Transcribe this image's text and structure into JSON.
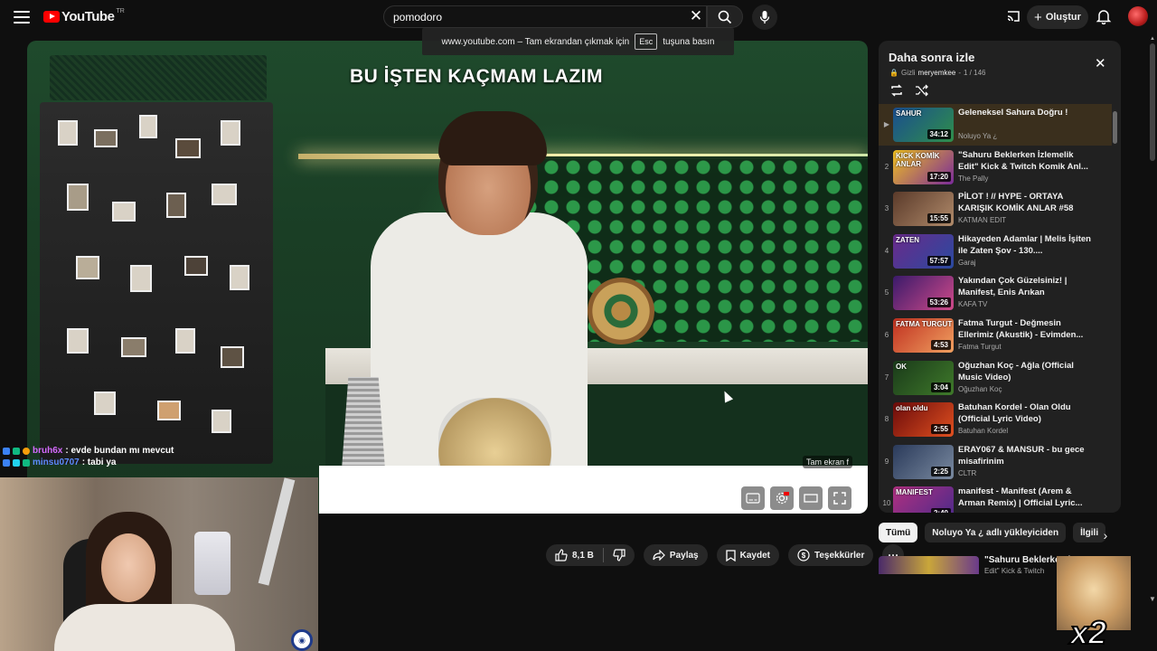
{
  "header": {
    "logo_text": "YouTube",
    "country_code": "TR",
    "search_value": "pomodoro",
    "create_label": "Oluştur",
    "icons": [
      "menu-icon",
      "youtube-logo-icon",
      "clear-icon",
      "search-icon",
      "mic-icon",
      "cast-icon",
      "plus-icon",
      "bell-icon",
      "avatar"
    ]
  },
  "fullscreen_notice": {
    "prefix": "www.youtube.com – Tam ekrandan çıkmak için",
    "key": "Esc",
    "suffix": "tuşuna basın"
  },
  "video": {
    "overlay_title": "BU İŞTEN KAÇMAM LAZIM",
    "tooltip": "Tam ekran",
    "tooltip_shortcut": "f",
    "controls": [
      "subtitles-icon",
      "settings-icon",
      "theater-icon",
      "fullscreen-icon"
    ]
  },
  "actions": {
    "like_count": "8,1 B",
    "share_label": "Paylaş",
    "save_label": "Kaydet",
    "thanks_label": "Teşekkürler"
  },
  "playlist": {
    "title": "Daha sonra izle",
    "privacy": "Gizli",
    "owner": "meryemkee",
    "position": "1 / 146",
    "active_color": "#3a2f1d",
    "items": [
      {
        "index": "▶",
        "title": "Geleneksel Sahura Doğru !",
        "channel": "Noluyo Ya ¿",
        "duration": "34:12",
        "thumb_text": "SAHUR"
      },
      {
        "index": "2",
        "title": "\"Sahuru Beklerken İzlemelik Edit\" Kick & Twitch Komik Anl...",
        "channel": "The Pally",
        "duration": "17:20",
        "thumb_text": "KICK KOMİK ANLAR"
      },
      {
        "index": "3",
        "title": "PİLOT ! // HYPE - ORTAYA KARIŞIK KOMİK ANLAR #58",
        "channel": "KATMAN EDIT",
        "duration": "15:55"
      },
      {
        "index": "4",
        "title": "Hikayeden Adamlar | Melis İşiten ile Zaten Şov - 130....",
        "channel": "Garaj",
        "duration": "57:57",
        "thumb_text": "ZATEN"
      },
      {
        "index": "5",
        "title": "Yakından Çok Güzelsiniz! | Manifest, Enis Arıkan",
        "channel": "KAFA TV",
        "duration": "53:26"
      },
      {
        "index": "6",
        "title": "Fatma Turgut - Değmesin Ellerimiz (Akustik) - Evimden...",
        "channel": "Fatma Turgut",
        "duration": "4:53",
        "thumb_text": "FATMA TURGUT"
      },
      {
        "index": "7",
        "title": "Oğuzhan Koç - Ağla (Official Music Video)",
        "channel": "Oğuzhan Koç",
        "duration": "3:04",
        "thumb_text": "OK"
      },
      {
        "index": "8",
        "title": "Batuhan Kordel - Olan Oldu (Official Lyric Video)",
        "channel": "Batuhan Kordel",
        "duration": "2:55",
        "thumb_text": "olan oldu"
      },
      {
        "index": "9",
        "title": "ERAY067 & MANSUR - bu gece misafirinim",
        "channel": "CLTR",
        "duration": "2:25"
      },
      {
        "index": "10",
        "title": "manifest - Manifest (Arem & Arman Remix) | Official Lyric...",
        "channel": "",
        "duration": "2:40",
        "thumb_text": "MANIFEST"
      }
    ]
  },
  "chips": [
    "Tümü",
    "Noluyo Ya ¿ adlı yükleyiciden",
    "İlgili"
  ],
  "recommended": {
    "title": "\"Sahuru Beklerken İ",
    "sub": "Edit\" Kick & Twitch"
  },
  "chat": [
    {
      "user": "bruh6x",
      "message": ": evde bundan mı mevcut",
      "color": "#d66bff"
    },
    {
      "user": "minsu0707",
      "message": ": tabi ya",
      "color": "#5c8cff"
    }
  ],
  "emote": {
    "text": "x2"
  }
}
